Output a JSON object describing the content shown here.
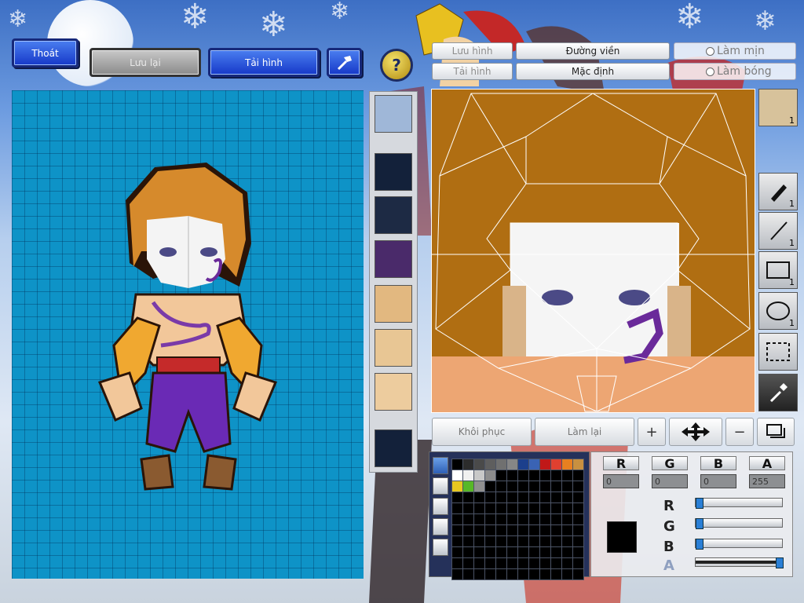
{
  "top_buttons": {
    "exit": "Thoát",
    "save": "Lưu lại",
    "reload": "Tải hình"
  },
  "editor_buttons": {
    "save_image": "Lưu hình",
    "load_image": "Tải hình",
    "outline": "Đường viền",
    "default": "Mặc định",
    "smooth": "Làm mịn",
    "shadow": "Làm bóng"
  },
  "thumbnail_count": "1",
  "tools": [
    {
      "name": "pen",
      "count": "1"
    },
    {
      "name": "line",
      "count": "1"
    },
    {
      "name": "rectangle",
      "count": "1"
    },
    {
      "name": "ellipse",
      "count": "1"
    },
    {
      "name": "select",
      "count": ""
    },
    {
      "name": "eyedropper",
      "count": ""
    }
  ],
  "bottom_buttons": {
    "restore": "Khôi phục",
    "redo": "Làm lại"
  },
  "color": {
    "channels": [
      "R",
      "G",
      "B",
      "A"
    ],
    "r": "0",
    "g": "0",
    "b": "0",
    "a": "255",
    "r_level": 0,
    "g_level": 0,
    "b_level": 0,
    "a_level": 1,
    "current": "#000000"
  },
  "palette_colors": [
    "#000000",
    "#2c2c2c",
    "#4a4a4a",
    "#5e5e5e",
    "#707070",
    "#868686",
    "#1c3f8c",
    "#3a63b4",
    "#c01818",
    "#e04030",
    "#e88020",
    "#c89040",
    "#ffffff",
    "#f0f0f0",
    "#c8c8c8",
    "#8c8c8c",
    "#000000",
    "#000000",
    "#000000",
    "#000000",
    "#000000",
    "#000000",
    "#000000",
    "#000000",
    "#e8c820",
    "#58b828",
    "#909090"
  ]
}
